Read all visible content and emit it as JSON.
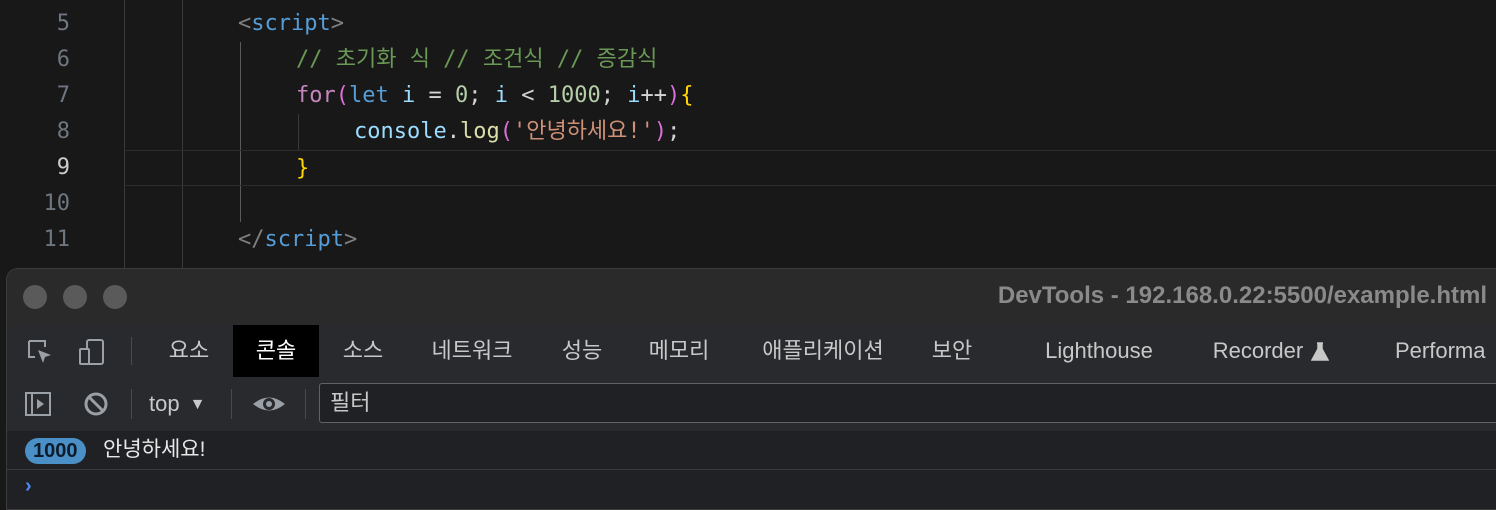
{
  "editor": {
    "lines": [
      {
        "num": "5"
      },
      {
        "num": "6"
      },
      {
        "num": "7"
      },
      {
        "num": "8"
      },
      {
        "num": "9"
      },
      {
        "num": "10"
      },
      {
        "num": "11"
      }
    ],
    "tokens": {
      "l5_open": "<",
      "l5_tag": "script",
      "l5_close": ">",
      "l6_comment": "// 초기화 식 // 조건식 // 증감식",
      "l7_for": "for",
      "l7_paren_open": "(",
      "l7_let": "let",
      "l7_i1": " i",
      "l7_eq": " = ",
      "l7_zero": "0",
      "l7_semi1": "; ",
      "l7_i2": "i",
      "l7_lt": " < ",
      "l7_num": "1000",
      "l7_semi2": "; ",
      "l7_i3": "i",
      "l7_inc": "++",
      "l7_paren_close": ")",
      "l7_brace": "{",
      "l8_console": "console",
      "l8_dot": ".",
      "l8_log": "log",
      "l8_po": "(",
      "l8_str": "'안녕하세요!'",
      "l8_pc": ")",
      "l8_semi": ";",
      "l9_brace": "}",
      "l11_open": "</",
      "l11_tag": "script",
      "l11_close": ">"
    }
  },
  "devtools": {
    "window_title": "DevTools - 192.168.0.22:5500/example.html",
    "icons": {
      "inspect": "inspect-element-icon",
      "device": "device-toolbar-icon",
      "sidebar": "sidebar-toggle-icon",
      "clear": "clear-console-icon",
      "eye": "live-expression-icon",
      "flask": "experimental-flask-icon"
    },
    "tabs": [
      {
        "label": "요소"
      },
      {
        "label": "콘솔"
      },
      {
        "label": "소스"
      },
      {
        "label": "네트워크"
      },
      {
        "label": "성능"
      },
      {
        "label": "메모리"
      },
      {
        "label": "애플리케이션"
      },
      {
        "label": "보안"
      },
      {
        "label": "Lighthouse"
      },
      {
        "label": "Recorder"
      },
      {
        "label": "Performa"
      }
    ],
    "context": "top",
    "filter_placeholder": "필터",
    "log": {
      "count": "1000",
      "message": "안녕하세요!"
    },
    "prompt": "›"
  }
}
